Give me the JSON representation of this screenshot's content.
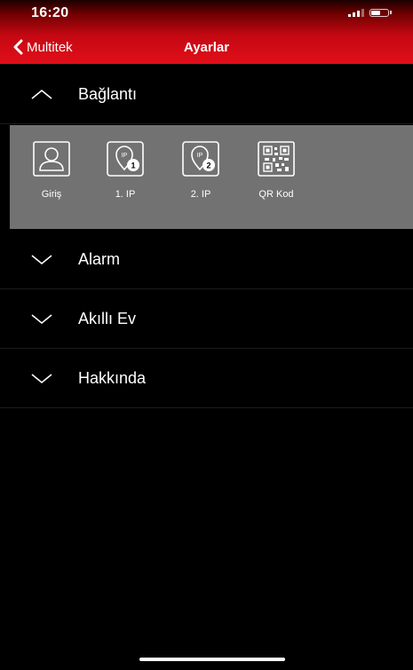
{
  "status_bar": {
    "time": "16:20"
  },
  "header": {
    "back_label": "Multitek",
    "title": "Ayarlar"
  },
  "sections": [
    {
      "label": "Bağlantı",
      "expanded": true
    },
    {
      "label": "Alarm",
      "expanded": false
    },
    {
      "label": "Akıllı Ev",
      "expanded": false
    },
    {
      "label": "Hakkında",
      "expanded": false
    }
  ],
  "connection_items": [
    {
      "label": "Giriş",
      "icon": "user-icon"
    },
    {
      "label": "1. IP",
      "icon": "ip-1-icon",
      "badge": "1",
      "icon_text": "IP"
    },
    {
      "label": "2. IP",
      "icon": "ip-2-icon",
      "badge": "2",
      "icon_text": "IP"
    },
    {
      "label": "QR Kod",
      "icon": "qr-code-icon"
    }
  ],
  "colors": {
    "header_red": "#e10f1a",
    "panel_gray": "#727272",
    "background": "#000000"
  }
}
